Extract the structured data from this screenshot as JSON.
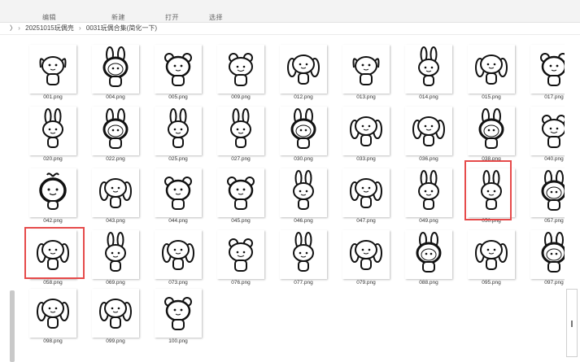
{
  "ribbon": {
    "labels": [
      "编辑",
      "新建",
      "打开",
      "选择"
    ]
  },
  "address": {
    "path": [
      "20251015玩偶壳",
      "0031玩偶合集(简化一下)"
    ]
  },
  "files": [
    {
      "name": "001.png",
      "icon": "puppy-ears-icon"
    },
    {
      "name": "004.png",
      "icon": "bunny-hood-icon"
    },
    {
      "name": "005.png",
      "icon": "bear-icon"
    },
    {
      "name": "009.png",
      "icon": "frog-icon"
    },
    {
      "name": "012.png",
      "icon": "long-ear-dog-icon"
    },
    {
      "name": "013.png",
      "icon": "puppy-ears-icon"
    },
    {
      "name": "014.png",
      "icon": "bunny-icon"
    },
    {
      "name": "015.png",
      "icon": "long-ear-dog-icon"
    },
    {
      "name": "017.png",
      "icon": "bear-icon"
    },
    {
      "name": "020.png",
      "icon": "bunny-icon"
    },
    {
      "name": "022.png",
      "icon": "bunny-hood-icon"
    },
    {
      "name": "025.png",
      "icon": "bunny-icon"
    },
    {
      "name": "027.png",
      "icon": "bunny-icon"
    },
    {
      "name": "030.png",
      "icon": "bunny-hood-icon"
    },
    {
      "name": "033.png",
      "icon": "long-ear-dog-icon"
    },
    {
      "name": "036.png",
      "icon": "long-ear-dog-icon"
    },
    {
      "name": "038.png",
      "icon": "bunny-hood-icon"
    },
    {
      "name": "040.png",
      "icon": "frog-icon"
    },
    {
      "name": "042.png",
      "icon": "sprout-icon"
    },
    {
      "name": "043.png",
      "icon": "long-ear-dog-icon"
    },
    {
      "name": "044.png",
      "icon": "bear-icon"
    },
    {
      "name": "045.png",
      "icon": "bear-icon"
    },
    {
      "name": "046.png",
      "icon": "bunny-icon"
    },
    {
      "name": "047.png",
      "icon": "long-ear-dog-icon"
    },
    {
      "name": "049.png",
      "icon": "bunny-icon"
    },
    {
      "name": "050.png",
      "icon": "bunny-icon"
    },
    {
      "name": "057.png",
      "icon": "bunny-hood-icon"
    },
    {
      "name": "058.png",
      "icon": "long-ear-dog-icon"
    },
    {
      "name": "069.png",
      "icon": "bunny-icon"
    },
    {
      "name": "073.png",
      "icon": "long-ear-dog-icon"
    },
    {
      "name": "076.png",
      "icon": "frog-icon"
    },
    {
      "name": "077.png",
      "icon": "bunny-icon"
    },
    {
      "name": "079.png",
      "icon": "long-ear-dog-icon"
    },
    {
      "name": "088.png",
      "icon": "bunny-hood-icon"
    },
    {
      "name": "095.png",
      "icon": "long-ear-dog-icon"
    },
    {
      "name": "097.png",
      "icon": "bunny-hood-icon"
    },
    {
      "name": "098.png",
      "icon": "long-ear-dog-icon"
    },
    {
      "name": "099.png",
      "icon": "long-ear-dog-icon"
    },
    {
      "name": "100.png",
      "icon": "bear-icon"
    }
  ],
  "highlight_color": "#e64b4b"
}
